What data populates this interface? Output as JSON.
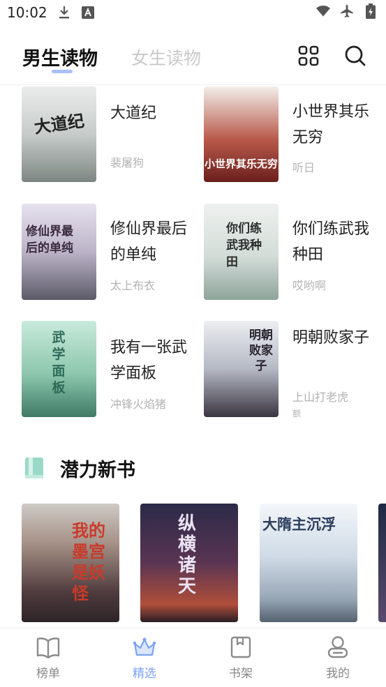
{
  "status_bar": {
    "time": "10:02",
    "left_icons": [
      "download-icon",
      "a-notification-icon"
    ],
    "right_icons": [
      "wifi-icon",
      "airplane-icon",
      "battery-icon"
    ]
  },
  "header": {
    "tabs": [
      {
        "label": "男生读物",
        "active": true
      },
      {
        "label": "女生读物",
        "active": false
      }
    ],
    "icons": [
      "grid-icon",
      "search-icon"
    ],
    "accent": "#a8c0ff"
  },
  "books": [
    {
      "title": "大道纪",
      "author": "裴屠狗",
      "cover_text": "大道纪",
      "cover_color": "#dfe3e2"
    },
    {
      "title": "小世界其乐无穷",
      "author": "听日",
      "cover_text": "小世界其乐无穷",
      "cover_color": "#9b3b36"
    },
    {
      "title": "修仙界最后的单纯",
      "author": "太上布衣",
      "cover_text": "修仙界最后的单纯",
      "cover_color": "#cfc7d8"
    },
    {
      "title": "你们练武我种田",
      "author": "哎哟啊",
      "cover_text": "你们练武我种田",
      "cover_color": "#dde6e3"
    },
    {
      "title": "我有一张武学面板",
      "author": "冲锋火焰猪",
      "cover_text": "武学面板",
      "cover_color": "#9fd0b4"
    },
    {
      "title": "明朝败家子",
      "author": "上山打老虎",
      "author_sub": "额",
      "cover_text": "明朝败家子",
      "cover_color": "#d9dbe0"
    }
  ],
  "section": {
    "title": "潜力新书",
    "icon": "book-icon",
    "icon_color": "#9ad9c8"
  },
  "new_books": [
    {
      "cover_text": "我的墨宫是妖怪",
      "cover_color": "#6b5553"
    },
    {
      "cover_text": "纵横诸天",
      "cover_color": "#3b2f4a"
    },
    {
      "cover_text": "大隋主沉浮",
      "cover_color": "#c3d1df"
    }
  ],
  "bottom_nav": [
    {
      "label": "榜单",
      "icon": "open-book-icon",
      "active": false
    },
    {
      "label": "精选",
      "icon": "crown-icon",
      "active": true
    },
    {
      "label": "书架",
      "icon": "bookshelf-icon",
      "active": false
    },
    {
      "label": "我的",
      "icon": "profile-icon",
      "active": false
    }
  ],
  "colors": {
    "active_nav": "#7da2f5",
    "muted": "#b3b3b3"
  }
}
